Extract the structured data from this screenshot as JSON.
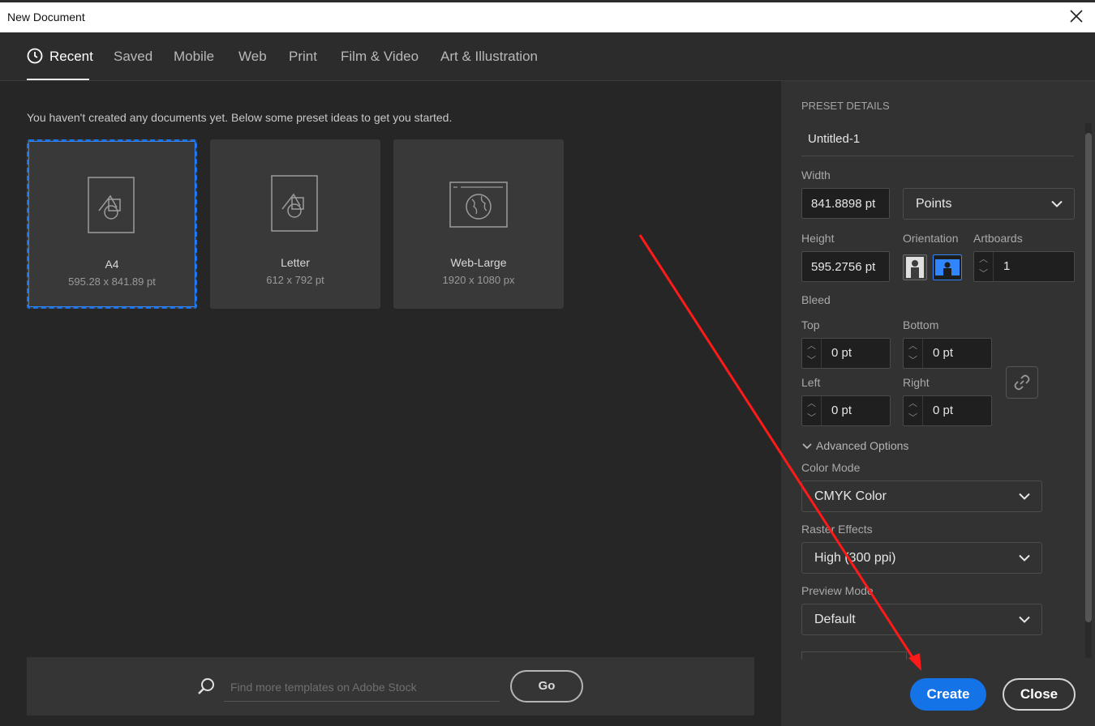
{
  "window": {
    "title": "New Document"
  },
  "tabs": [
    {
      "label": "Recent",
      "icon": "clock-icon",
      "active": true
    },
    {
      "label": "Saved"
    },
    {
      "label": "Mobile"
    },
    {
      "label": "Web"
    },
    {
      "label": "Print"
    },
    {
      "label": "Film & Video"
    },
    {
      "label": "Art & Illustration"
    }
  ],
  "main": {
    "intro_text": "You haven't created any documents yet. Below some preset ideas to get you started.",
    "presets": [
      {
        "name": "A4",
        "dims": "595.28 x 841.89 pt",
        "icon": "document-shapes-icon",
        "selected": true
      },
      {
        "name": "Letter",
        "dims": "612 x 792 pt",
        "icon": "document-shapes-icon",
        "selected": false
      },
      {
        "name": "Web-Large",
        "dims": "1920 x 1080 px",
        "icon": "browser-globe-icon",
        "selected": false
      }
    ],
    "search": {
      "placeholder": "Find more templates on Adobe Stock",
      "go_label": "Go"
    }
  },
  "panel": {
    "heading": "PRESET DETAILS",
    "doc_name": "Untitled-1",
    "width_label": "Width",
    "width_value": "841.8898 pt",
    "units_value": "Points",
    "height_label": "Height",
    "height_value": "595.2756 pt",
    "orientation_label": "Orientation",
    "artboards_label": "Artboards",
    "artboards_value": "1",
    "bleed_label": "Bleed",
    "bleed": {
      "top_label": "Top",
      "top_value": "0 pt",
      "bottom_label": "Bottom",
      "bottom_value": "0 pt",
      "left_label": "Left",
      "left_value": "0 pt",
      "right_label": "Right",
      "right_value": "0 pt"
    },
    "advanced_label": "Advanced Options",
    "color_mode_label": "Color Mode",
    "color_mode_value": "CMYK Color",
    "raster_label": "Raster Effects",
    "raster_value": "High (300 ppi)",
    "preview_label": "Preview Mode",
    "preview_value": "Default"
  },
  "footer": {
    "create_label": "Create",
    "close_label": "Close"
  },
  "colors": {
    "accent": "#1473e6",
    "annotation_arrow": "#ff1a1a"
  }
}
